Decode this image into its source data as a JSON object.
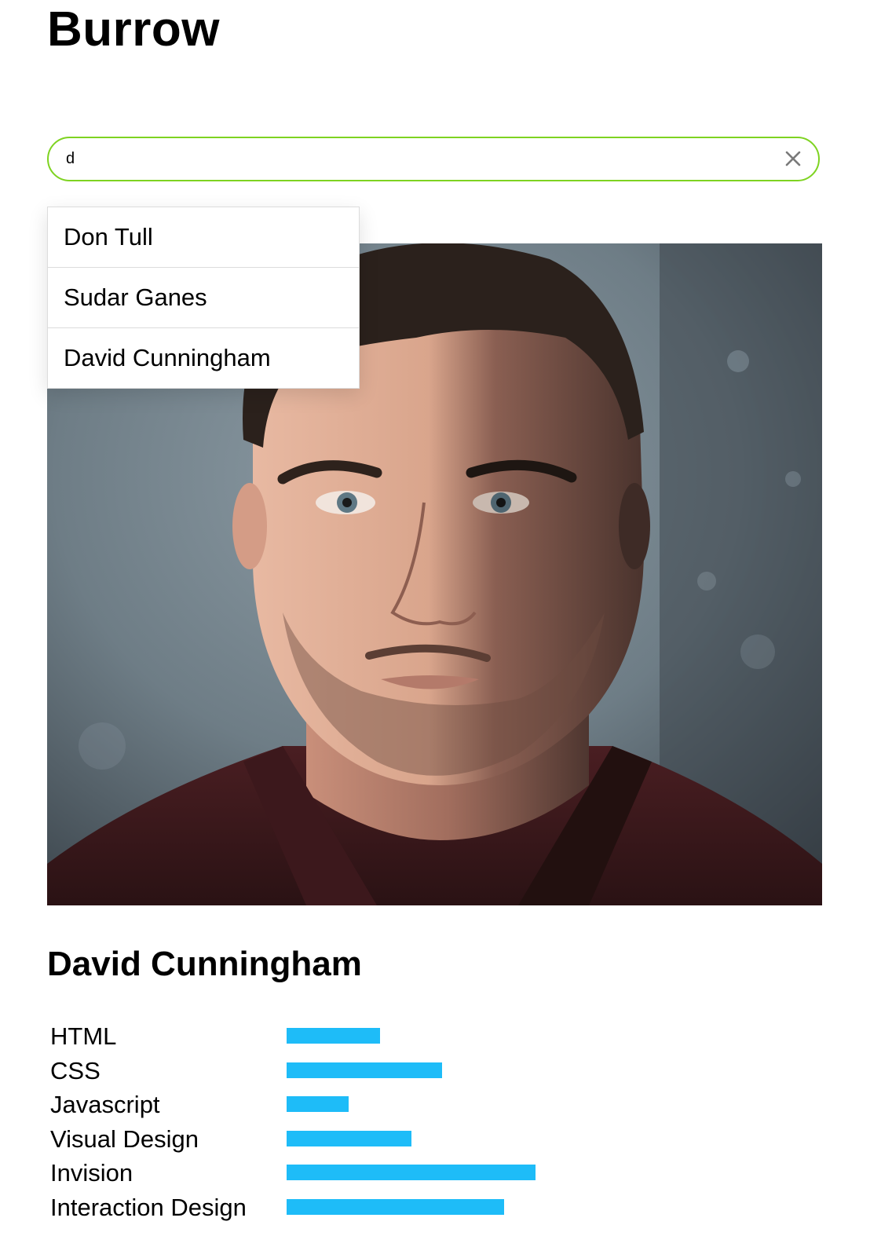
{
  "app": {
    "title": "Burrow"
  },
  "search": {
    "value": "d",
    "placeholder": "",
    "clear_icon": "close-icon"
  },
  "dropdown": {
    "items": [
      {
        "label": "Don Tull"
      },
      {
        "label": "Sudar Ganes"
      },
      {
        "label": "David Cunningham"
      }
    ]
  },
  "profile": {
    "name": "David Cunningham",
    "photo": "portrait-photo",
    "skills": [
      {
        "label": "HTML",
        "level": 0.375
      },
      {
        "label": "CSS",
        "level": 0.625
      },
      {
        "label": "Javascript",
        "level": 0.25
      },
      {
        "label": "Visual Design",
        "level": 0.5
      },
      {
        "label": "Invision",
        "level": 1.0
      },
      {
        "label": "Interaction Design",
        "level": 0.875
      }
    ]
  },
  "colors": {
    "search_border": "#7ed321",
    "skill_bar": "#1ebcf8"
  }
}
